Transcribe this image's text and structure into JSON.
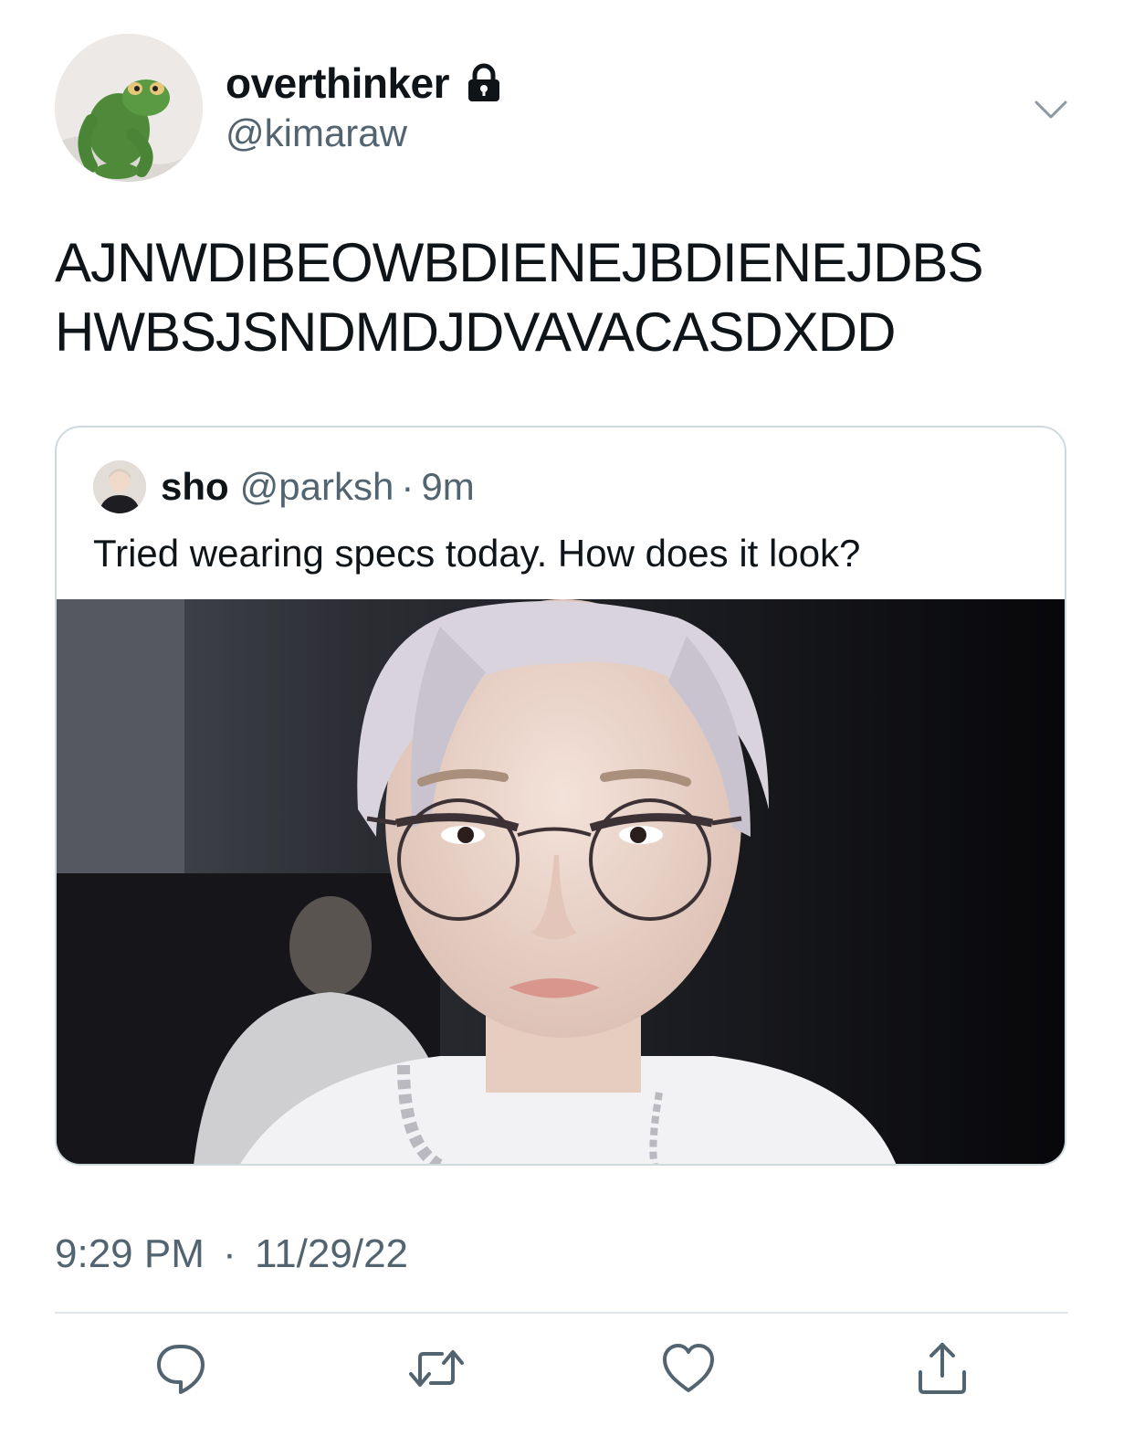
{
  "author": {
    "display_name": "overthinker",
    "handle": "@kimaraw",
    "protected_icon": "lock-icon"
  },
  "tweet": {
    "text_lines": [
      "AJNWDIBEOWBDIENEJBDIENEJDBS",
      "HWBSJSNDMDJDVAVACASDXDD"
    ],
    "time": "9:29 PM",
    "separator": "·",
    "date": "11/29/22"
  },
  "quoted_tweet": {
    "display_name": "sho",
    "handle": "@parksh",
    "separator": "·",
    "time": "9m",
    "text": "Tried wearing specs today. How does it look?",
    "media_icon": "photo"
  },
  "menu_icon": "chevron-down-icon",
  "actions": [
    {
      "icon": "reply-icon"
    },
    {
      "icon": "retweet-icon"
    },
    {
      "icon": "like-icon"
    },
    {
      "icon": "share-icon"
    }
  ],
  "colors": {
    "text_primary": "#0f1419",
    "text_secondary": "#536471",
    "border": "#cfd9de",
    "icon": "#536471"
  }
}
